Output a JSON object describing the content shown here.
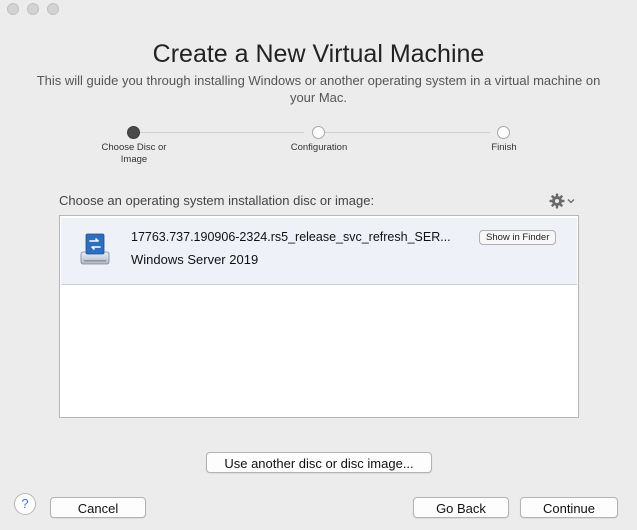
{
  "window": {
    "title": "Create a New Virtual Machine",
    "subtitle": "This will guide you through installing Windows or another operating system in a virtual machine on your Mac."
  },
  "steps": [
    {
      "label": "Choose Disc or Image",
      "state": "current"
    },
    {
      "label": "Configuration",
      "state": "pending"
    },
    {
      "label": "Finish",
      "state": "pending"
    }
  ],
  "selection": {
    "prompt": "Choose an operating system installation disc or image:",
    "gear_icon": "gear-icon",
    "items": [
      {
        "filename": "17763.737.190906-2324.rs5_release_svc_refresh_SER...",
        "os_name": "Windows Server 2019",
        "show_in_finder": "Show in Finder",
        "icon": "disc-image-icon"
      }
    ]
  },
  "buttons": {
    "use_another": "Use another disc or disc image...",
    "help": "?",
    "cancel": "Cancel",
    "go_back": "Go Back",
    "continue": "Continue"
  },
  "colors": {
    "window_bg": "#ececec",
    "selected_row_bg": "#eef1f7",
    "active_step": "#4a4a4a",
    "help_accent": "#3a7bd5"
  }
}
